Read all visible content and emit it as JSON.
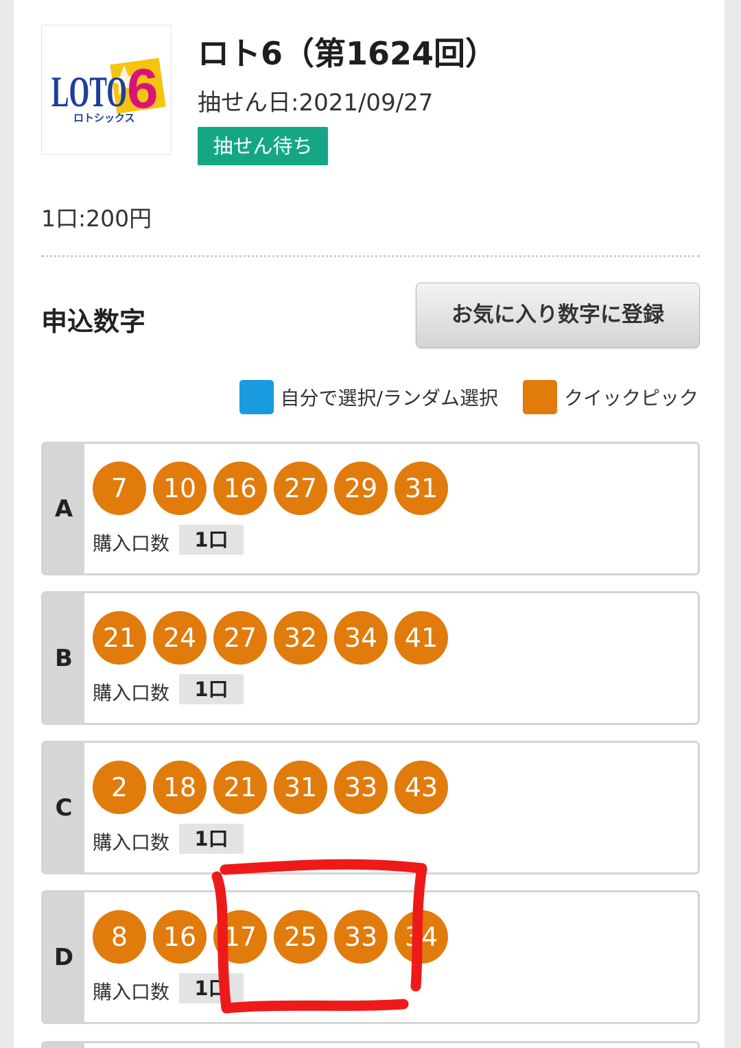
{
  "header": {
    "logo": {
      "wordmark": "LOTO",
      "numeral": "6",
      "subtitle": "ロトシックス",
      "colors": {
        "blue": "#1d3f9a",
        "yellow": "#f5c40f",
        "magenta": "#d9127a"
      }
    },
    "title": "ロト6（第1624回）",
    "draw_date": "抽せん日:2021/09/27",
    "status": "抽せん待ち",
    "status_color": "#15a785"
  },
  "price": "1口:200円",
  "section": {
    "title": "申込数字",
    "favorite_button": "お気に入り数字に登録"
  },
  "legend": {
    "manual": {
      "label": "自分で選択/ランダム選択",
      "color": "#1a9be0"
    },
    "quick": {
      "label": "クイックピック",
      "color": "#e07b0c"
    }
  },
  "tickets": [
    {
      "letter": "A",
      "numbers": [
        "7",
        "10",
        "16",
        "27",
        "29",
        "31"
      ],
      "qty_label": "購入口数",
      "qty": "1口"
    },
    {
      "letter": "B",
      "numbers": [
        "21",
        "24",
        "27",
        "32",
        "34",
        "41"
      ],
      "qty_label": "購入口数",
      "qty": "1口"
    },
    {
      "letter": "C",
      "numbers": [
        "2",
        "18",
        "21",
        "31",
        "33",
        "43"
      ],
      "qty_label": "購入口数",
      "qty": "1口"
    },
    {
      "letter": "D",
      "numbers": [
        "8",
        "16",
        "17",
        "25",
        "33",
        "34"
      ],
      "qty_label": "購入口数",
      "qty": "1口"
    }
  ],
  "annotation_color": "#ee1a1a"
}
